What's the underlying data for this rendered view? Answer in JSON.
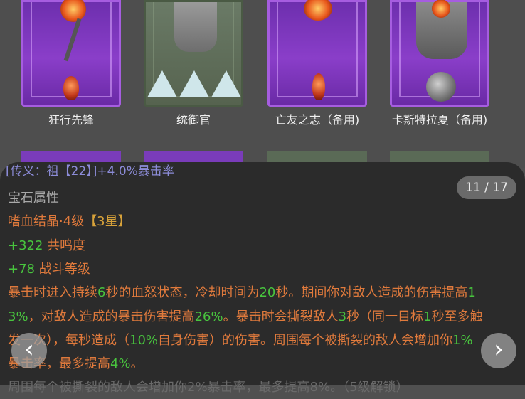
{
  "equipment": [
    {
      "label": "狂行先锋"
    },
    {
      "label": "统御官"
    },
    {
      "label": "亡友之志（备用)"
    },
    {
      "label": "卡斯特拉夏（备用)"
    }
  ],
  "partial_line": "[传义：祖【22】]+4.0%暴击率",
  "counter": "11 / 17",
  "section_title": "宝石属性",
  "gem_name": "嗜血结晶·4级",
  "gem_stars": "【3星】",
  "stat1_value": "+322",
  "stat1_label": " 共鸣度",
  "stat2_value": "+78",
  "stat2_label": " 战斗等级",
  "desc": {
    "l1a": "暴击时进入持续",
    "l1b": "6",
    "l1c": "秒的血怒状态，冷却时间为",
    "l1d": "20",
    "l1e": "秒。期间你对敌人造成的伤害提高",
    "l1f": "1",
    "l2a": "3%",
    "l2b": "，对敌人造成的暴击伤害提高",
    "l2c": "26%",
    "l2d": "。暴击时会撕裂敌人",
    "l2e": "3",
    "l2f": "秒（同一目标",
    "l2g": "1",
    "l2h": "秒至多触",
    "l3a": "发一次），每秒造成（",
    "l3b": "10%",
    "l3c": "自身伤害）的伤害。周围每个被撕裂的敌人会增加你",
    "l3d": "1%",
    "l4a": "暴击率，最多提高",
    "l4b": "4%",
    "l4c": "。",
    "l5": "周围每个被撕裂的敌人会增加你2%暴击率，最多提高8%。（5级解锁）"
  },
  "colors": {
    "orange": "#e07a3c",
    "green": "#48c43e",
    "yellow": "#d7a23a"
  },
  "icons": {
    "prev": "chevron-left-icon",
    "next": "chevron-right-icon"
  }
}
